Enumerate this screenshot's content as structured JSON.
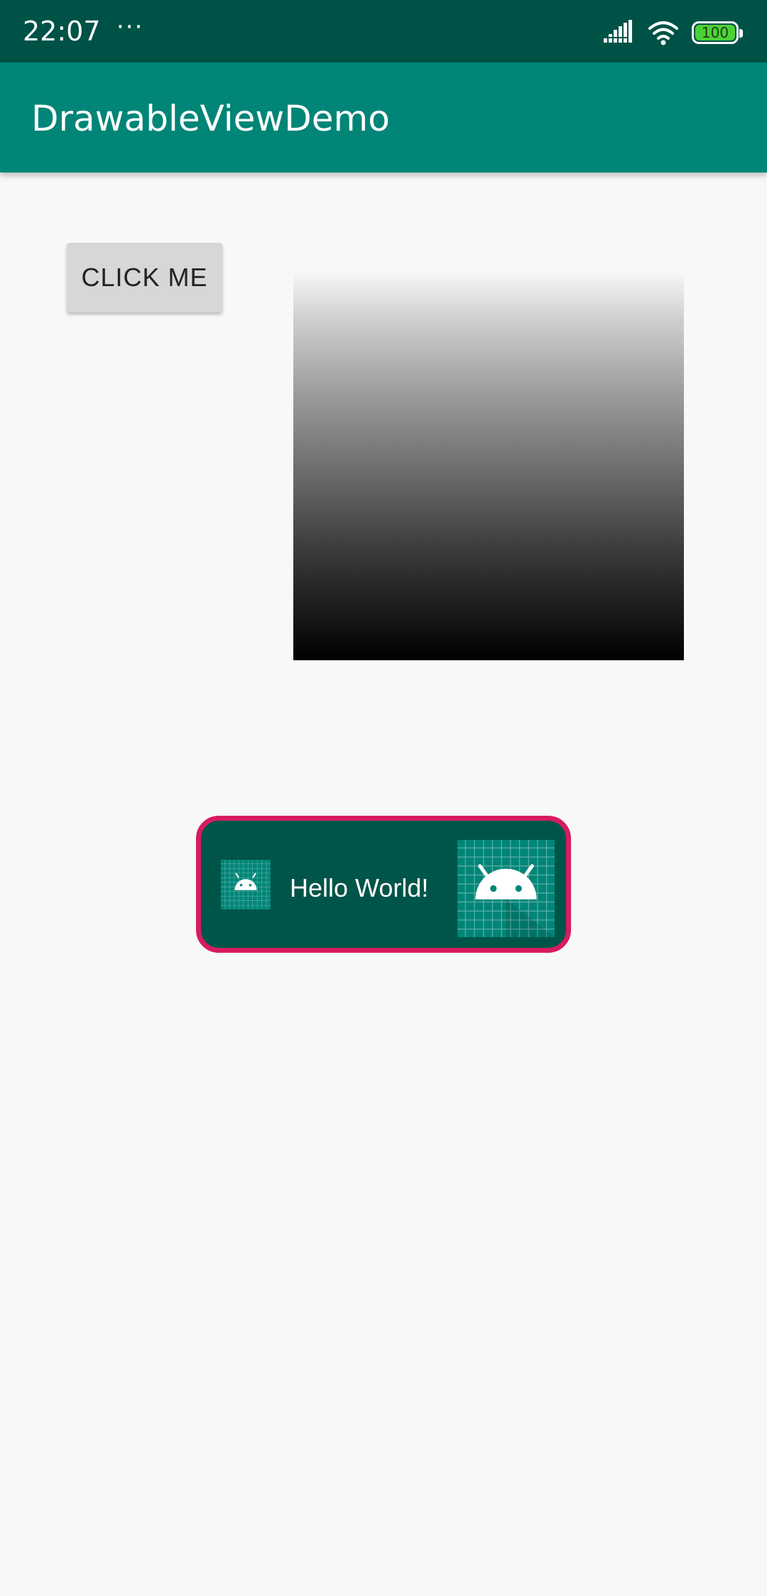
{
  "status_bar": {
    "time": "22:07",
    "more": "···",
    "battery": "100"
  },
  "app_bar": {
    "title": "DrawableViewDemo"
  },
  "button": {
    "label": "CLICK ME"
  },
  "drawable_view": {
    "text": "Hello World!"
  },
  "colors": {
    "status_bar": "#005246",
    "app_bar": "#008577",
    "background": "#f7f9f7",
    "drawable_fill": "#005549",
    "drawable_border": "#d81b60",
    "battery_fill": "#4cd137"
  },
  "icons": [
    "signal-icon",
    "wifi-icon",
    "battery-icon",
    "android-icon"
  ]
}
